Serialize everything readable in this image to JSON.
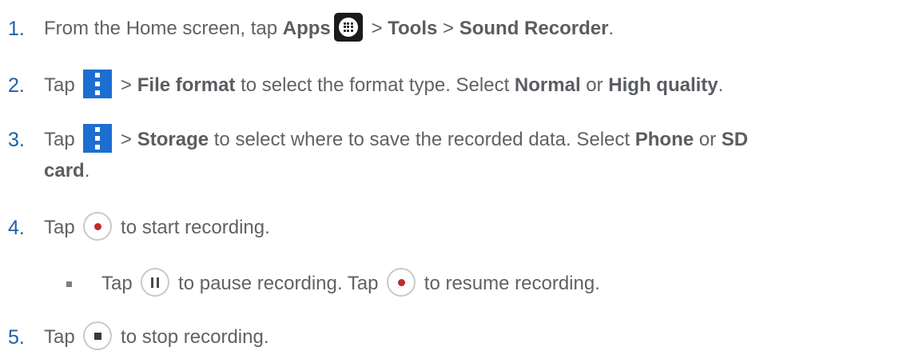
{
  "steps": [
    {
      "number": "1.",
      "t1": "From the Home screen, tap ",
      "b1": "Apps",
      "t2": " > ",
      "b2": "Tools",
      "t3": " > ",
      "b3": "Sound Recorder",
      "t4": ".",
      "icon": "apps-icon"
    },
    {
      "number": "2.",
      "t1": "Tap ",
      "t2": " > ",
      "b1": "File format",
      "t3": " to select the format type. Select ",
      "b2": "Normal",
      "t4": " or ",
      "b3": "High quality",
      "t5": ".",
      "icon": "menu-icon"
    },
    {
      "number": "3.",
      "t1": "Tap ",
      "t2": " > ",
      "b1": "Storage",
      "t3": " to select where to save the recorded data. Select ",
      "b2": "Phone",
      "t4": " or ",
      "b3": "SD",
      "b4": "card",
      "t5": ".",
      "icon": "menu-icon"
    },
    {
      "number": "4.",
      "t1": "Tap ",
      "t2": " to start recording.",
      "icon": "record-icon"
    },
    {
      "number": "5.",
      "t1": "Tap ",
      "t2": " to stop recording.",
      "icon": "stop-icon"
    }
  ],
  "substep": {
    "t1": "Tap ",
    "t2": " to pause recording. Tap ",
    "t3": " to resume recording.",
    "icons": [
      "pause-icon",
      "record-icon"
    ]
  }
}
